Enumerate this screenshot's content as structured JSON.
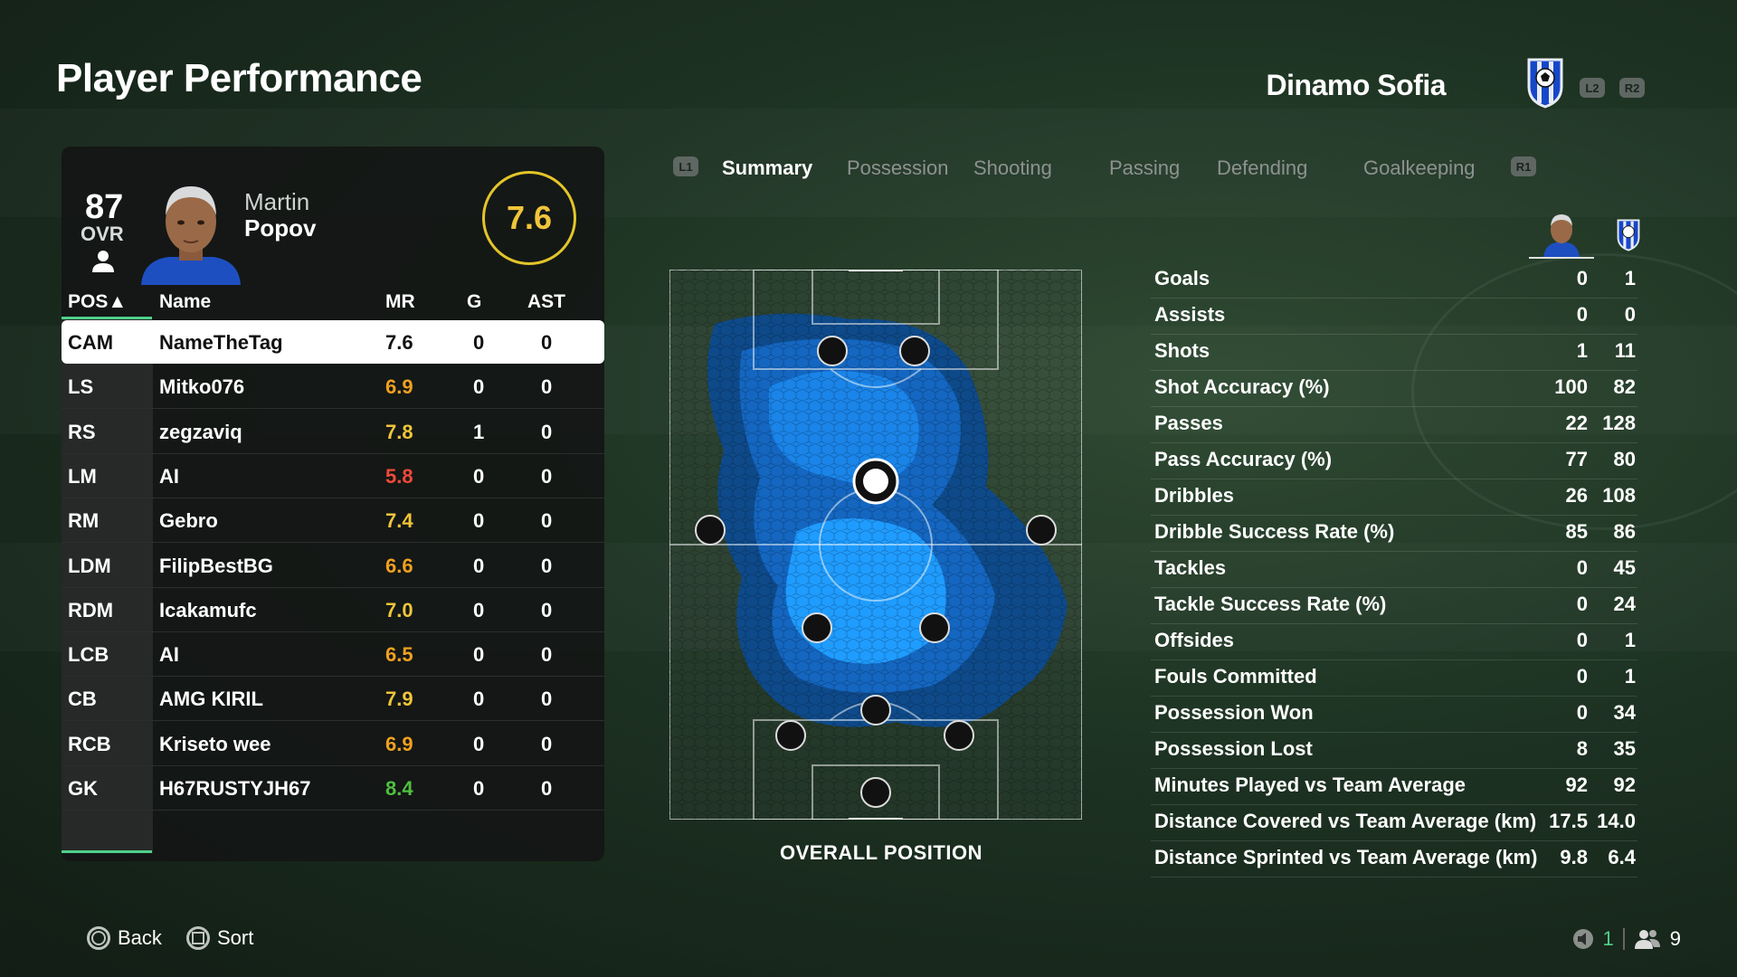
{
  "page": {
    "title": "Player Performance"
  },
  "team": {
    "name": "Dinamo Sofia",
    "l2": "L2",
    "r2": "R2"
  },
  "player": {
    "ovr": "87",
    "ovr_label": "OVR",
    "first_name": "Martin",
    "last_name": "Popov",
    "rating": "7.6"
  },
  "table": {
    "headers": {
      "pos": "POS▲",
      "name": "Name",
      "mr": "MR",
      "g": "G",
      "ast": "AST"
    },
    "rows": [
      {
        "pos": "CAM",
        "name": "NameTheTag",
        "mr": "7.6",
        "g": "0",
        "ast": "0",
        "mr_color": "#111111"
      },
      {
        "pos": "LS",
        "name": "Mitko076",
        "mr": "6.9",
        "g": "0",
        "ast": "0",
        "mr_color": "#f0a020"
      },
      {
        "pos": "RS",
        "name": "zegzaviq",
        "mr": "7.8",
        "g": "1",
        "ast": "0",
        "mr_color": "#f0c53a"
      },
      {
        "pos": "LM",
        "name": "AI",
        "mr": "5.8",
        "g": "0",
        "ast": "0",
        "mr_color": "#ef4a3a"
      },
      {
        "pos": "RM",
        "name": "Gebro",
        "mr": "7.4",
        "g": "0",
        "ast": "0",
        "mr_color": "#f0c53a"
      },
      {
        "pos": "LDM",
        "name": "FilipBestBG",
        "mr": "6.6",
        "g": "0",
        "ast": "0",
        "mr_color": "#f0a020"
      },
      {
        "pos": "RDM",
        "name": "Icakamufc",
        "mr": "7.0",
        "g": "0",
        "ast": "0",
        "mr_color": "#f0c53a"
      },
      {
        "pos": "LCB",
        "name": "AI",
        "mr": "6.5",
        "g": "0",
        "ast": "0",
        "mr_color": "#f0a020"
      },
      {
        "pos": "CB",
        "name": "AMG KIRIL",
        "mr": "7.9",
        "g": "0",
        "ast": "0",
        "mr_color": "#f0c53a"
      },
      {
        "pos": "RCB",
        "name": "Kriseto wee",
        "mr": "6.9",
        "g": "0",
        "ast": "0",
        "mr_color": "#f0a020"
      },
      {
        "pos": "GK",
        "name": "H67RUSTYJH67",
        "mr": "8.4",
        "g": "0",
        "ast": "0",
        "mr_color": "#4fc040"
      }
    ]
  },
  "tabs": {
    "l1": "L1",
    "r1": "R1",
    "items": [
      {
        "label": "Summary",
        "active": true
      },
      {
        "label": "Possession",
        "active": false
      },
      {
        "label": "Shooting",
        "active": false
      },
      {
        "label": "Passing",
        "active": false
      },
      {
        "label": "Defending",
        "active": false
      },
      {
        "label": "Goalkeeping",
        "active": false
      }
    ]
  },
  "heatmap": {
    "caption": "OVERALL POSITION"
  },
  "stats": [
    {
      "label": "Goals",
      "player": "0",
      "team": "1"
    },
    {
      "label": "Assists",
      "player": "0",
      "team": "0"
    },
    {
      "label": "Shots",
      "player": "1",
      "team": "11"
    },
    {
      "label": "Shot Accuracy (%)",
      "player": "100",
      "team": "82"
    },
    {
      "label": "Passes",
      "player": "22",
      "team": "128"
    },
    {
      "label": "Pass Accuracy (%)",
      "player": "77",
      "team": "80"
    },
    {
      "label": "Dribbles",
      "player": "26",
      "team": "108"
    },
    {
      "label": "Dribble Success Rate (%)",
      "player": "85",
      "team": "86"
    },
    {
      "label": "Tackles",
      "player": "0",
      "team": "45"
    },
    {
      "label": "Tackle Success Rate (%)",
      "player": "0",
      "team": "24"
    },
    {
      "label": "Offsides",
      "player": "0",
      "team": "1"
    },
    {
      "label": "Fouls Committed",
      "player": "0",
      "team": "1"
    },
    {
      "label": "Possession Won",
      "player": "0",
      "team": "34"
    },
    {
      "label": "Possession Lost",
      "player": "8",
      "team": "35"
    },
    {
      "label": "Minutes Played vs Team Average",
      "player": "92",
      "team": "92"
    },
    {
      "label": "Distance Covered vs Team Average (km)",
      "player": "17.5",
      "team": "14.0"
    },
    {
      "label": "Distance Sprinted vs Team Average (km)",
      "player": "9.8",
      "team": "6.4"
    }
  ],
  "footer": {
    "back": "Back",
    "sort": "Sort",
    "count1": "1",
    "count2": "9"
  },
  "colors": {
    "accent_green": "#4fd08a",
    "rating_ring": "#e3c52a",
    "heat_blue": "#1a8cff"
  }
}
